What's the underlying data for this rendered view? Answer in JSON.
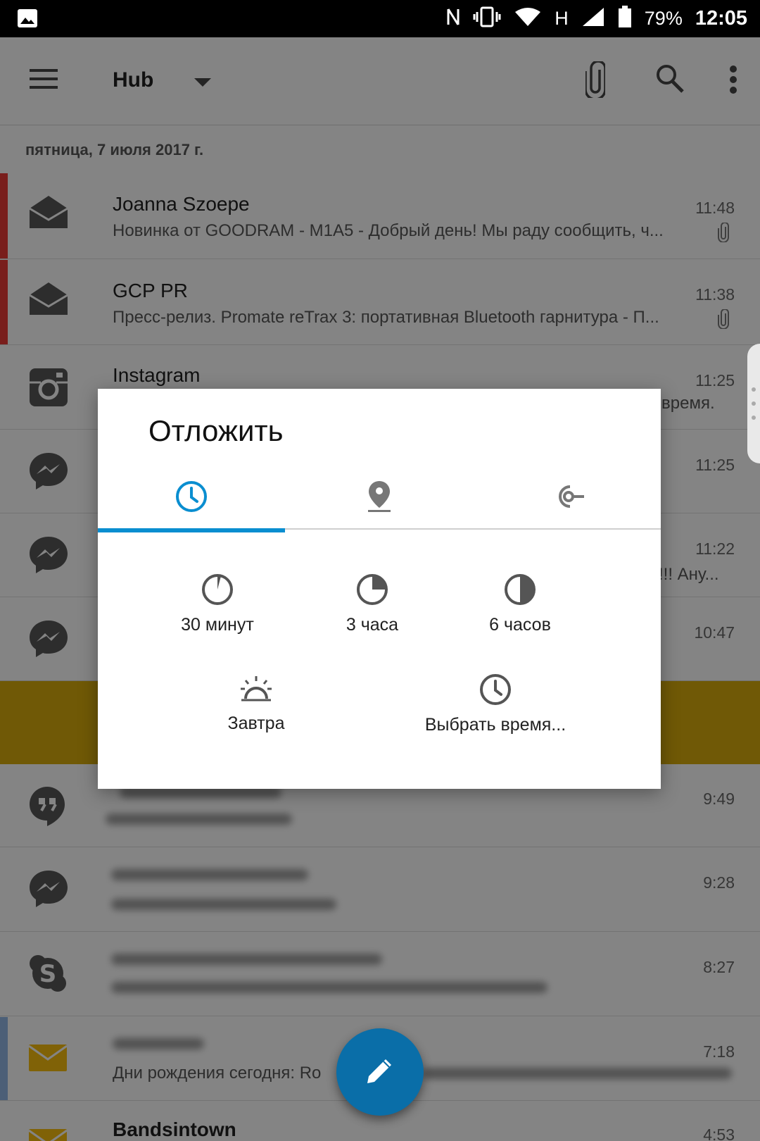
{
  "status_bar": {
    "battery": "79%",
    "time": "12:05",
    "network": "H"
  },
  "app_bar": {
    "title": "Hub"
  },
  "list": {
    "date_header": "пятница, 7 июля 2017 г.",
    "rows": [
      {
        "sender": "Joanna Szoepe",
        "time": "11:48",
        "snippet": "Новинка от GOODRAM - M1A5  - Добрый день! Мы раду сообщить, ч...",
        "icon": "envelope-open-icon"
      },
      {
        "sender": "GCP PR",
        "time": "11:38",
        "snippet": "Пресс-релиз. Promate reTrax 3: портативная Bluetooth гарнитура - П...",
        "icon": "envelope-open-icon"
      },
      {
        "sender": "Instagram",
        "time": "11:25",
        "snippet": "время.",
        "icon": "instagram-icon"
      },
      {
        "time": "11:25",
        "icon": "messenger-icon"
      },
      {
        "time": "11:22",
        "snippet": "!!! Ану...",
        "icon": "messenger-icon"
      },
      {
        "time": "10:47",
        "icon": "messenger-icon"
      },
      {
        "time": "9:49",
        "icon": "hangouts-icon"
      },
      {
        "time": "9:28",
        "icon": "messenger-icon"
      },
      {
        "time": "8:27",
        "icon": "skype-icon"
      },
      {
        "time": "7:18",
        "snippet": "Дни рождения сегодня: Ro",
        "icon": "envelope-icon"
      },
      {
        "sender": "Bandsintown",
        "time": "4:53",
        "icon": "envelope-icon"
      }
    ]
  },
  "dialog": {
    "title": "Отложить",
    "tabs": [
      {
        "name": "time",
        "icon": "clock-icon",
        "active": true
      },
      {
        "name": "location",
        "icon": "location-pin-icon",
        "active": false
      },
      {
        "name": "connection",
        "icon": "connection-icon",
        "active": false
      }
    ],
    "options": [
      {
        "label": "30 минут",
        "icon": "pie-30min-icon"
      },
      {
        "label": "3 часа",
        "icon": "pie-3h-icon"
      },
      {
        "label": "6 часов",
        "icon": "pie-6h-icon"
      },
      {
        "label": "Завтра",
        "icon": "sunrise-icon"
      },
      {
        "label": "Выбрать время...",
        "icon": "clock-icon"
      }
    ]
  },
  "colors": {
    "accent": "#0a8ed0",
    "fab": "#0a6ea8",
    "stripe_red": "#e53935",
    "stripe_blue": "#90b4e0",
    "highlight_yellow": "#d4a90c",
    "envelope_yellow": "#f2b90f"
  },
  "fab": {
    "icon": "pencil-icon"
  }
}
